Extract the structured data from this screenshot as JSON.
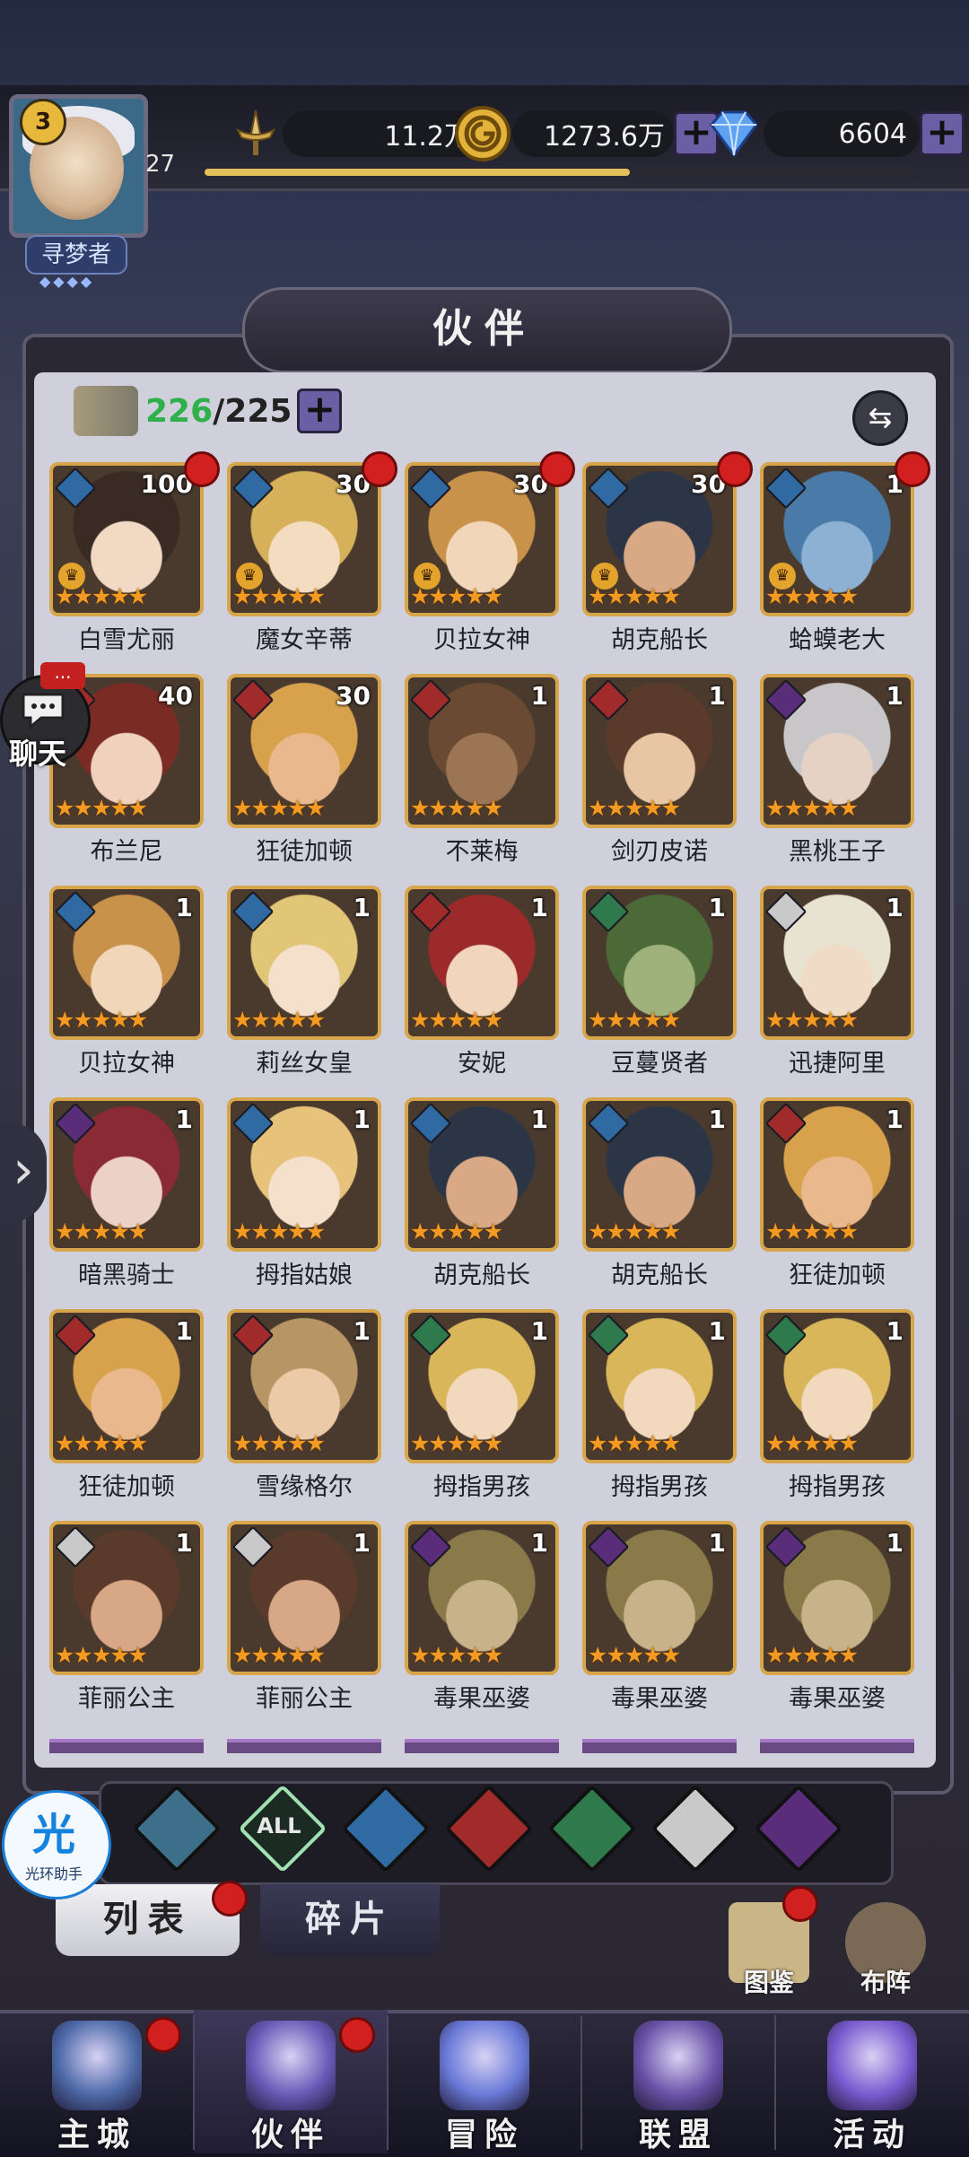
{
  "player": {
    "avatar_level": "3",
    "level": "27",
    "name": "寻梦者",
    "exp_fraction": 0.6
  },
  "resources": {
    "power": "11.2万",
    "gold": "1273.6万",
    "gems": "6604"
  },
  "panel": {
    "title": "伙伴",
    "owned": "226",
    "capacity": "/225"
  },
  "element_colors": {
    "water": "#2f6aa3",
    "fire": "#a12a2a",
    "wind": "#2f7a4d",
    "light": "#c9c9c9",
    "dark": "#5a2d7a"
  },
  "cards": [
    {
      "name": "白雪尤丽",
      "level": "100",
      "element": "water",
      "crown": true,
      "dot": true,
      "hair": "#3a2a24",
      "skin": "#f1d9c4"
    },
    {
      "name": "魔女辛蒂",
      "level": "30",
      "element": "water",
      "crown": true,
      "dot": true,
      "hair": "#d7b05a",
      "skin": "#f4dcc1"
    },
    {
      "name": "贝拉女神",
      "level": "30",
      "element": "water",
      "crown": true,
      "dot": true,
      "hair": "#c9924a",
      "skin": "#f1d6b9"
    },
    {
      "name": "胡克船长",
      "level": "30",
      "element": "water",
      "crown": true,
      "dot": true,
      "hair": "#2c3546",
      "skin": "#d9a985"
    },
    {
      "name": "蛤蟆老大",
      "level": "1",
      "element": "water",
      "crown": true,
      "dot": true,
      "hair": "#4a7aa8",
      "skin": "#8cb1d3"
    },
    {
      "name": "布兰尼",
      "level": "40",
      "element": "fire",
      "crown": false,
      "dot": false,
      "hair": "#7a2b24",
      "skin": "#f0d2bc"
    },
    {
      "name": "狂徒加顿",
      "level": "30",
      "element": "fire",
      "crown": false,
      "dot": false,
      "hair": "#d8a24c",
      "skin": "#e9b98d"
    },
    {
      "name": "不莱梅",
      "level": "1",
      "element": "fire",
      "crown": false,
      "dot": false,
      "hair": "#6a4a32",
      "skin": "#9c7554"
    },
    {
      "name": "剑刃皮诺",
      "level": "1",
      "element": "fire",
      "crown": false,
      "dot": false,
      "hair": "#5a3a2a",
      "skin": "#e8c6a4"
    },
    {
      "name": "黑桃王子",
      "level": "1",
      "element": "dark",
      "crown": false,
      "dot": false,
      "hair": "#c9c6c9",
      "skin": "#e6d2c4"
    },
    {
      "name": "贝拉女神",
      "level": "1",
      "element": "water",
      "crown": false,
      "dot": false,
      "hair": "#c9924a",
      "skin": "#f1d6b9"
    },
    {
      "name": "莉丝女皇",
      "level": "1",
      "element": "water",
      "crown": false,
      "dot": false,
      "hair": "#e2c678",
      "skin": "#f4e0cb"
    },
    {
      "name": "安妮",
      "level": "1",
      "element": "fire",
      "crown": false,
      "dot": false,
      "hair": "#9c2a2a",
      "skin": "#f1d6bd"
    },
    {
      "name": "豆蔓贤者",
      "level": "1",
      "element": "wind",
      "crown": false,
      "dot": false,
      "hair": "#4c6a38",
      "skin": "#9fb27c"
    },
    {
      "name": "迅捷阿里",
      "level": "1",
      "element": "light",
      "crown": false,
      "dot": false,
      "hair": "#e8e2d0",
      "skin": "#f0dcc6"
    },
    {
      "name": "暗黑骑士",
      "level": "1",
      "element": "dark",
      "crown": false,
      "dot": false,
      "hair": "#8a2a34",
      "skin": "#ecd2c6"
    },
    {
      "name": "拇指姑娘",
      "level": "1",
      "element": "water",
      "crown": false,
      "dot": false,
      "hair": "#e6c27a",
      "skin": "#f4e0cb"
    },
    {
      "name": "胡克船长",
      "level": "1",
      "element": "water",
      "crown": false,
      "dot": false,
      "hair": "#2c3546",
      "skin": "#d9a985"
    },
    {
      "name": "胡克船长",
      "level": "1",
      "element": "water",
      "crown": false,
      "dot": false,
      "hair": "#2c3546",
      "skin": "#d9a985"
    },
    {
      "name": "狂徒加顿",
      "level": "1",
      "element": "fire",
      "crown": false,
      "dot": false,
      "hair": "#d8a24c",
      "skin": "#e9b98d"
    },
    {
      "name": "狂徒加顿",
      "level": "1",
      "element": "fire",
      "crown": false,
      "dot": false,
      "hair": "#d8a24c",
      "skin": "#e9b98d"
    },
    {
      "name": "雪缘格尔",
      "level": "1",
      "element": "fire",
      "crown": false,
      "dot": false,
      "hair": "#b89564",
      "skin": "#eccaa8"
    },
    {
      "name": "拇指男孩",
      "level": "1",
      "element": "wind",
      "crown": false,
      "dot": false,
      "hair": "#d9b65a",
      "skin": "#f2d9bd"
    },
    {
      "name": "拇指男孩",
      "level": "1",
      "element": "wind",
      "crown": false,
      "dot": false,
      "hair": "#d9b65a",
      "skin": "#f2d9bd"
    },
    {
      "name": "拇指男孩",
      "level": "1",
      "element": "wind",
      "crown": false,
      "dot": false,
      "hair": "#d9b65a",
      "skin": "#f2d9bd"
    },
    {
      "name": "菲丽公主",
      "level": "1",
      "element": "light",
      "crown": false,
      "dot": false,
      "hair": "#5a3a2a",
      "skin": "#d8a886"
    },
    {
      "name": "菲丽公主",
      "level": "1",
      "element": "light",
      "crown": false,
      "dot": false,
      "hair": "#5a3a2a",
      "skin": "#d8a886"
    },
    {
      "name": "毒果巫婆",
      "level": "1",
      "element": "dark",
      "crown": false,
      "dot": false,
      "hair": "#8a7a4a",
      "skin": "#c8b28a"
    },
    {
      "name": "毒果巫婆",
      "level": "1",
      "element": "dark",
      "crown": false,
      "dot": false,
      "hair": "#8a7a4a",
      "skin": "#c8b28a"
    },
    {
      "name": "毒果巫婆",
      "level": "1",
      "element": "dark",
      "crown": false,
      "dot": false,
      "hair": "#8a7a4a",
      "skin": "#c8b28a"
    }
  ],
  "stars_text": "★★★★★",
  "filters": {
    "all_label": "ALL",
    "items": [
      "moon",
      "all",
      "water",
      "fire",
      "wind",
      "light",
      "dark"
    ]
  },
  "tabs": {
    "list": "列表",
    "fragments": "碎片"
  },
  "side_buttons": {
    "codex": "图鉴",
    "formation": "布阵"
  },
  "chat": {
    "label": "聊天",
    "badge": "..."
  },
  "helper": {
    "main": "光",
    "sub": "光环助手"
  },
  "nav": [
    {
      "label": "主城",
      "dot": true,
      "color": "#4d6aa8"
    },
    {
      "label": "伙伴",
      "dot": true,
      "color": "#6a5ab8"
    },
    {
      "label": "冒险",
      "dot": false,
      "color": "#6a7ad8"
    },
    {
      "label": "联盟",
      "dot": false,
      "color": "#6a52a8"
    },
    {
      "label": "活动",
      "dot": false,
      "color": "#7a5ad0"
    }
  ]
}
